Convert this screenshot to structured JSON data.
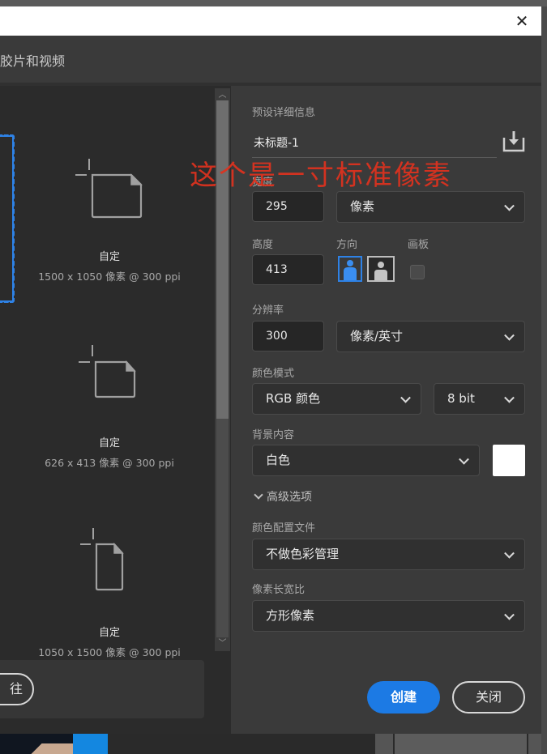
{
  "window": {
    "close_icon": "close-x"
  },
  "header": {
    "title": "胶片和视频"
  },
  "presets": [
    {
      "name": "自定",
      "size": "1500 x 1050 像素 @ 300 ppi",
      "icon": "new-document-landscape-icon"
    },
    {
      "name": "自定",
      "size": "626 x 413 像素 @ 300 ppi",
      "icon": "new-document-landscape-icon"
    },
    {
      "name": "自定",
      "size": "1050 x 1500 像素 @ 300 ppi",
      "icon": "new-document-portrait-icon"
    }
  ],
  "left_bottom": {
    "button_label": "往"
  },
  "details": {
    "section_title": "预设详细信息",
    "doc_name": "未标题-1",
    "save_preset_icon": "download-icon",
    "width": {
      "label": "宽度",
      "value": "295",
      "unit": "像素"
    },
    "height": {
      "label": "高度",
      "value": "413"
    },
    "orientation": {
      "label": "方向",
      "selected": "portrait",
      "options": [
        "portrait",
        "landscape"
      ]
    },
    "artboard": {
      "label": "画板",
      "checked": false
    },
    "resolution": {
      "label": "分辨率",
      "value": "300",
      "unit": "像素/英寸"
    },
    "color_mode": {
      "label": "颜色模式",
      "value": "RGB 颜色",
      "bit_depth": "8 bit"
    },
    "background": {
      "label": "背景内容",
      "value": "白色",
      "swatch_color": "#ffffff"
    },
    "advanced": {
      "label": "高级选项"
    },
    "color_profile": {
      "label": "颜色配置文件",
      "value": "不做色彩管理"
    },
    "pixel_aspect": {
      "label": "像素长宽比",
      "value": "方形像素"
    }
  },
  "actions": {
    "create": "创建",
    "close": "关闭"
  },
  "annotation": {
    "text": "这个是一寸标准像素",
    "color": "#e0321e"
  },
  "colors": {
    "accent": "#1c7ae4",
    "selection": "#2e82e6"
  }
}
